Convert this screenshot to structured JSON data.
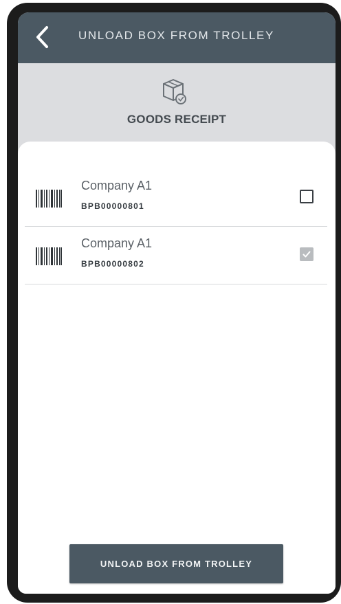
{
  "header": {
    "title": "UNLOAD BOX FROM TROLLEY",
    "back_icon": "chevron-left-icon"
  },
  "banner": {
    "icon": "box-receipt-icon",
    "title": "GOODS RECEIPT"
  },
  "items": [
    {
      "company": "Company A1",
      "code": "BPB00000801",
      "checked": false,
      "icon": "barcode-icon"
    },
    {
      "company": "Company A1",
      "code": "BPB00000802",
      "checked": true,
      "icon": "barcode-icon"
    }
  ],
  "actions": {
    "primary_label": "UNLOAD BOX FROM TROLLEY"
  },
  "colors": {
    "header_bg": "#4b5963",
    "banner_bg": "#dcdde0",
    "button_bg": "#4b5963",
    "frame": "#1c1c1c"
  }
}
